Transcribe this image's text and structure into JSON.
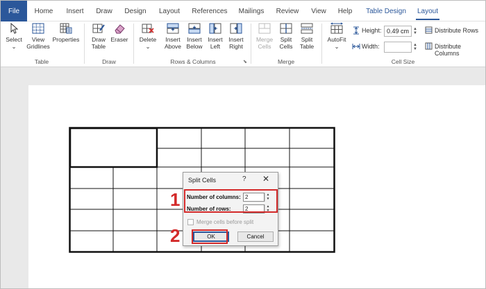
{
  "tabs": [
    {
      "label": "File"
    },
    {
      "label": "Home"
    },
    {
      "label": "Insert"
    },
    {
      "label": "Draw"
    },
    {
      "label": "Design"
    },
    {
      "label": "Layout"
    },
    {
      "label": "References"
    },
    {
      "label": "Mailings"
    },
    {
      "label": "Review"
    },
    {
      "label": "View"
    },
    {
      "label": "Help"
    },
    {
      "label": "Table Design"
    },
    {
      "label": "Layout"
    }
  ],
  "ribbon": {
    "select": "Select",
    "view_gridlines": "View\nGridlines",
    "view_gridlines_1": "View",
    "view_gridlines_2": "Gridlines",
    "properties": "Properties",
    "table_group": "Table",
    "draw_table_1": "Draw",
    "draw_table_2": "Table",
    "eraser": "Eraser",
    "draw_group": "Draw",
    "delete": "Delete",
    "insert_above_1": "Insert",
    "insert_above_2": "Above",
    "insert_below_1": "Insert",
    "insert_below_2": "Below",
    "insert_left_1": "Insert",
    "insert_left_2": "Left",
    "insert_right_1": "Insert",
    "insert_right_2": "Right",
    "rows_columns_group": "Rows & Columns",
    "merge_cells_1": "Merge",
    "merge_cells_2": "Cells",
    "split_cells_1": "Split",
    "split_cells_2": "Cells",
    "split_table_1": "Split",
    "split_table_2": "Table",
    "merge_group": "Merge",
    "autofit": "AutoFit",
    "height_label": "Height:",
    "height_value": "0.49 cm",
    "width_label": "Width:",
    "width_value": "",
    "distribute_rows": "Distribute Rows",
    "distribute_columns": "Distribute Columns",
    "cell_size_group": "Cell Size"
  },
  "dialog": {
    "title": "Split Cells",
    "help": "?",
    "close": "✕",
    "columns_label": "Number of columns:",
    "columns_value": "2",
    "rows_label": "Number of rows:",
    "rows_value": "2",
    "merge_before_split": "Merge cells before split",
    "merge_before_split_checked": false,
    "ok": "OK",
    "cancel": "Cancel"
  },
  "annotations": {
    "step1": "1",
    "step2": "2"
  },
  "colors": {
    "accent": "#2b579a",
    "highlight": "#d32a2a",
    "ribbon_bg": "#ffffff",
    "canvas_bg": "#e9e9e9"
  },
  "icons": [
    "select-icon",
    "gridlines-icon",
    "properties-icon",
    "draw-table-icon",
    "eraser-icon",
    "delete-icon",
    "insert-above-icon",
    "insert-below-icon",
    "insert-left-icon",
    "insert-right-icon",
    "merge-cells-icon",
    "split-cells-icon",
    "split-table-icon",
    "autofit-icon",
    "height-icon",
    "width-icon",
    "distribute-rows-icon",
    "distribute-columns-icon"
  ]
}
